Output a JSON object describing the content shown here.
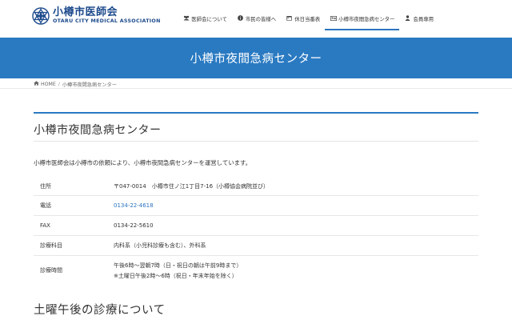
{
  "header": {
    "logo_jp": "小樽市医師会",
    "logo_en": "OTARU CITY MEDICAL ASSOCIATION",
    "brand_color": "#1c4a8c",
    "nav": [
      {
        "label": "医師会について",
        "icon": "users-icon"
      },
      {
        "label": "市民の皆様へ",
        "icon": "info-icon"
      },
      {
        "label": "休日当番表",
        "icon": "calendar-icon"
      },
      {
        "label": "小樽市夜間急病センター",
        "icon": "id-card-icon",
        "active": true
      },
      {
        "label": "会員専用",
        "icon": "user-icon"
      }
    ]
  },
  "hero": {
    "title": "小樽市夜間急病センター",
    "color": "#2a7ac2"
  },
  "breadcrumb": {
    "home": "HOME",
    "separator": "/",
    "current": "小樽市夜間急病センター"
  },
  "main": {
    "heading": "小樽市夜間急病センター",
    "intro": "小樽市医師会は小樽市の依頼により、小樽市夜間急病センターを運営しています。",
    "table": [
      {
        "label": "住所",
        "value": "〒047-0014　小樽市住ノ江1丁目7-16（小樽協会病院並び）"
      },
      {
        "label": "電話",
        "value": "0134-22-4618",
        "link": true
      },
      {
        "label": "FAX",
        "value": "0134-22-5610"
      },
      {
        "label": "診療科目",
        "value": "内科系（小児科診療も含む）、外科系"
      },
      {
        "label": "診療時間",
        "value": "午後6時〜翌朝7時（日・祝日の朝は午前9時まで）",
        "value2": "※土曜日午後2時〜6時（祝日・年末年始を除く）"
      }
    ],
    "subheading": "土曜午後の診療について"
  }
}
